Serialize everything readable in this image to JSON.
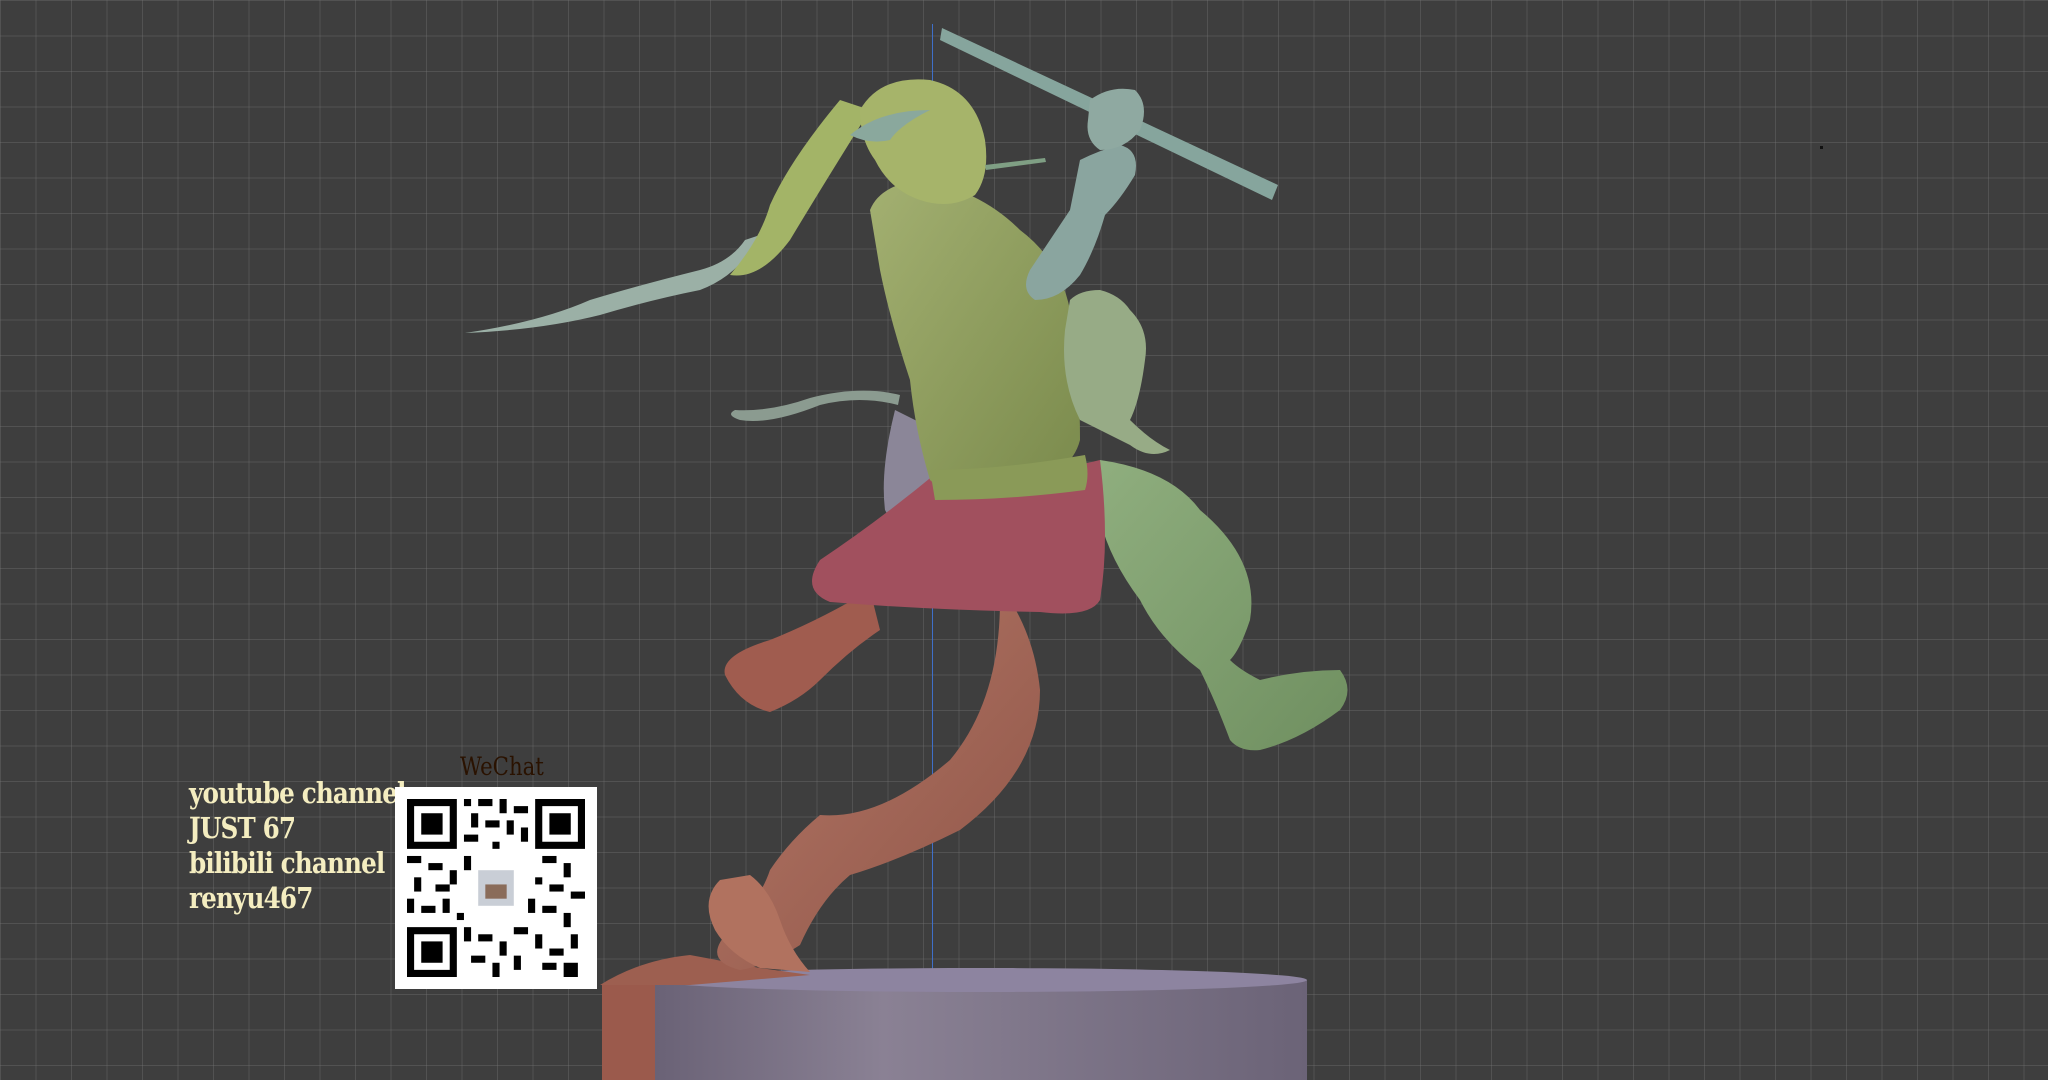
{
  "credits": {
    "line1": "youtube channel",
    "line2": "JUST 67",
    "line3": "bilibili channel",
    "line4": "renyu467"
  },
  "wechat": {
    "label": "WeChat",
    "qr_icon": "qr-code-icon"
  },
  "colors": {
    "background": "#3e3e3e",
    "grid": "#5a5a5a",
    "center_line": "#3f6fc8",
    "credit_text": "#f4edc0",
    "wechat_text": "#2a1200",
    "body_green": "#8b9a5b",
    "skin_green": "#92a56e",
    "pants_brown": "#a5685a",
    "skirt_red": "#9c4c5a",
    "teal_parts": "#7f9a92",
    "base_purple": "#7c7284"
  }
}
